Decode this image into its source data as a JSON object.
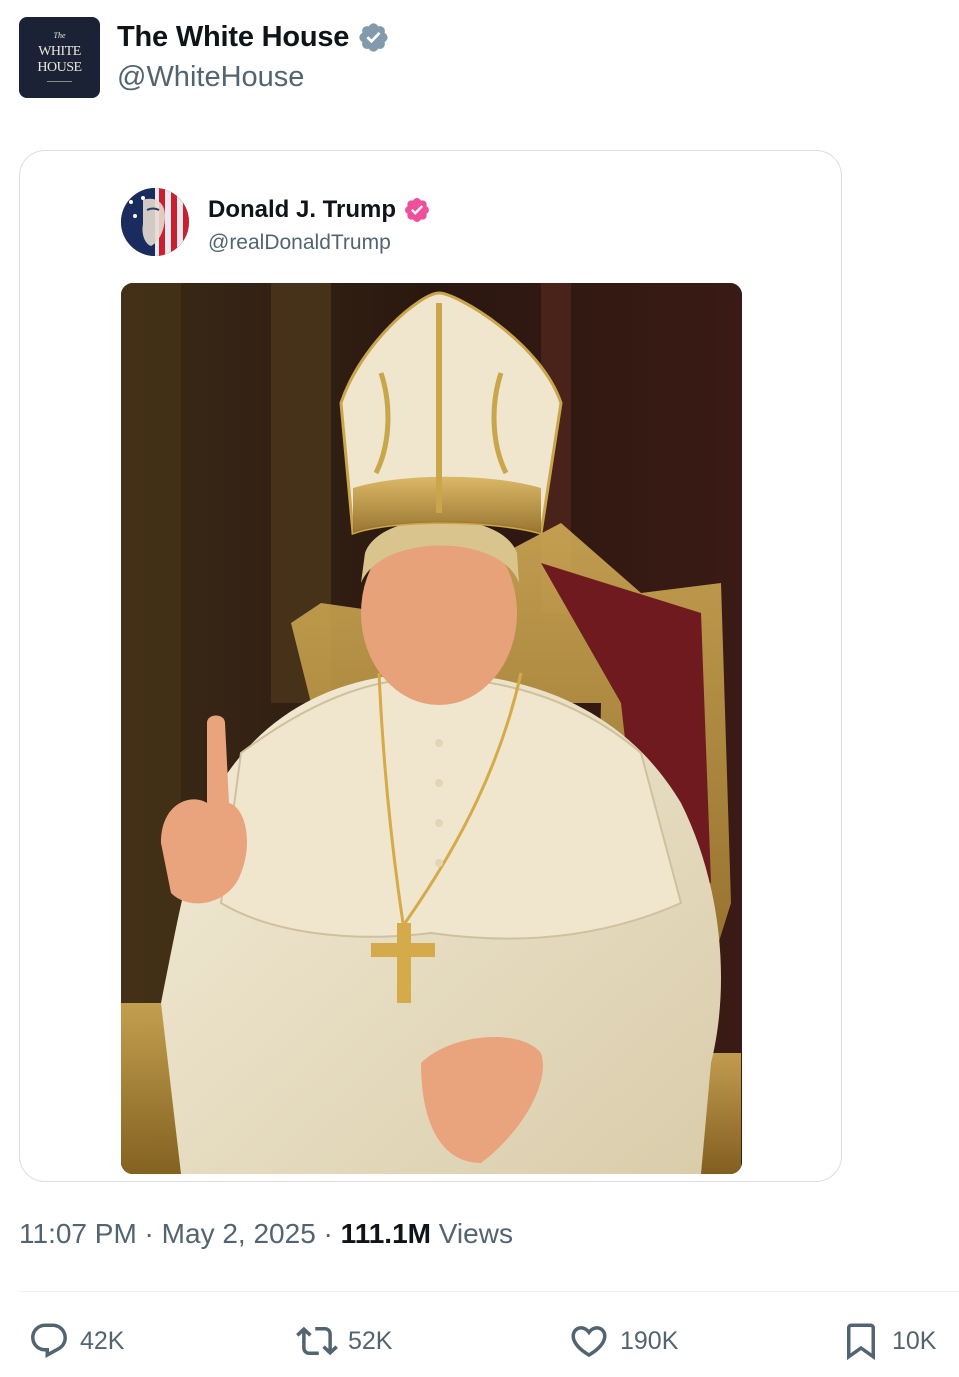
{
  "post": {
    "author": {
      "display_name": "The White House",
      "handle": "@WhiteHouse",
      "avatar_logo": {
        "the": "The",
        "line1": "WHITE",
        "line2": "HOUSE"
      },
      "verified_color": "#829aab"
    },
    "quoted": {
      "author": {
        "display_name": "Donald J. Trump",
        "handle": "@realDonaldTrump",
        "verified_color": "#f0509a"
      },
      "media_icon": "ai-portrait-image"
    },
    "meta": {
      "time": "11:07 PM",
      "separator": " · ",
      "date": "May 2, 2025",
      "views_count": "111.1M",
      "views_label": "Views"
    },
    "actions": {
      "replies": "42K",
      "reposts": "52K",
      "likes": "190K",
      "bookmarks": "10K"
    }
  },
  "colors": {
    "text_primary": "#0f1419",
    "text_secondary": "#536471",
    "border": "#d9dee2"
  }
}
